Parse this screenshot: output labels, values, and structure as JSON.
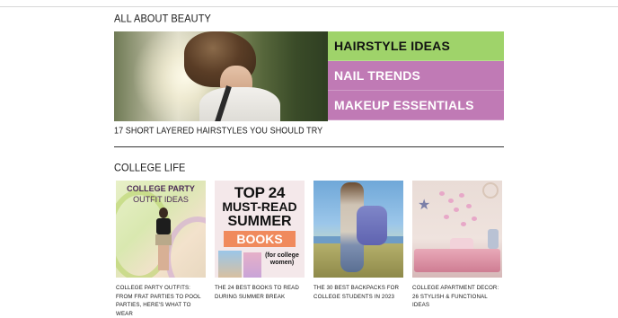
{
  "beauty": {
    "heading": "ALL ABOUT BEAUTY",
    "menu": [
      "HAIRSTYLE IDEAS",
      "NAIL TRENDS",
      "MAKEUP ESSENTIALS"
    ],
    "active_index": 0,
    "feature_caption": "17 SHORT LAYERED HAIRSTYLES YOU SHOULD TRY"
  },
  "college": {
    "heading": "COLLEGE LIFE",
    "cards": [
      {
        "image_text": [
          "COLLEGE PARTY",
          "OUTFIT IDEAS"
        ],
        "title": "COLLEGE PARTY OUTFITS: FROM FRAT PARTIES TO POOL PARTIES, HERE'S WHAT TO WEAR"
      },
      {
        "image_text": [
          "TOP 24",
          "MUST-READ",
          "SUMMER",
          "BOOKS",
          "(for college women)"
        ],
        "title": "THE 24 BEST BOOKS TO READ DURING SUMMER BREAK"
      },
      {
        "title": "THE 30 BEST BACKPACKS FOR COLLEGE STUDENTS IN 2023"
      },
      {
        "title": "COLLEGE APARTMENT DECOR: 26 STYLISH & FUNCTIONAL IDEAS"
      }
    ]
  },
  "colors": {
    "menu_active": "#9fd36a",
    "menu_default": "#c07ab5"
  }
}
